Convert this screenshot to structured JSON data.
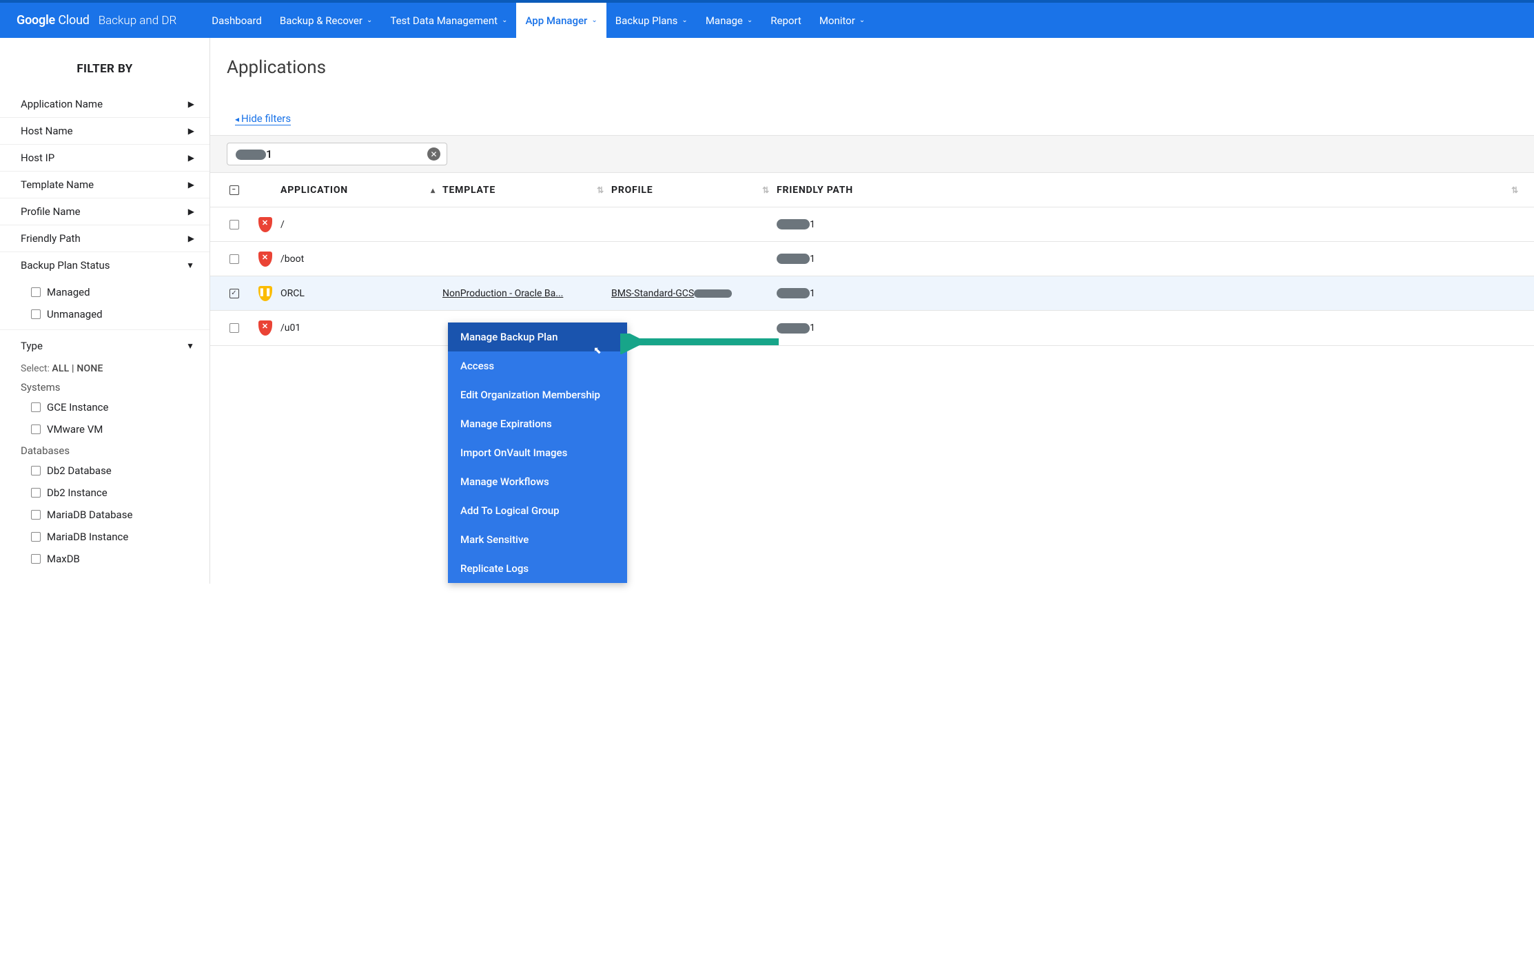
{
  "brand": {
    "google": "Google",
    "cloud": "Cloud",
    "product": "Backup and DR"
  },
  "nav": {
    "dashboard": "Dashboard",
    "backup_recover": "Backup & Recover",
    "test_data": "Test Data Management",
    "app_manager": "App Manager",
    "backup_plans": "Backup Plans",
    "manage": "Manage",
    "report": "Report",
    "monitor": "Monitor"
  },
  "sidebar": {
    "title": "FILTER BY",
    "filters": [
      "Application Name",
      "Host Name",
      "Host IP",
      "Template Name",
      "Profile Name",
      "Friendly Path",
      "Backup Plan Status"
    ],
    "plan_status_options": [
      "Managed",
      "Unmanaged"
    ],
    "type_label": "Type",
    "select_label": "Select:",
    "select_all": "ALL",
    "select_sep": " | ",
    "select_none": "NONE",
    "systems_label": "Systems",
    "systems": [
      "GCE Instance",
      "VMware VM"
    ],
    "databases_label": "Databases",
    "databases": [
      "Db2 Database",
      "Db2 Instance",
      "MariaDB Database",
      "MariaDB Instance",
      "MaxDB"
    ]
  },
  "page": {
    "title": "Applications",
    "hide_filters": "Hide filters",
    "chip_suffix": "1"
  },
  "cols": {
    "application": "APPLICATION",
    "template": "TEMPLATE",
    "profile": "PROFILE",
    "friendly": "FRIENDLY PATH"
  },
  "rows": [
    {
      "icon": "red",
      "app": "/",
      "template": "",
      "profile": "",
      "friendly_suffix": "1",
      "checked": false
    },
    {
      "icon": "red",
      "app": "/boot",
      "template": "",
      "profile": "",
      "friendly_suffix": "1",
      "checked": false
    },
    {
      "icon": "yellow",
      "app": "ORCL",
      "template": "NonProduction - Oracle Ba...",
      "profile": "BMS-Standard-GCS",
      "friendly_suffix": "1",
      "checked": true
    },
    {
      "icon": "red",
      "app": "/u01",
      "template": "",
      "profile": "",
      "friendly_suffix": "1",
      "checked": false
    }
  ],
  "ctx": {
    "items": [
      "Manage Backup Plan",
      "Access",
      "Edit Organization Membership",
      "Manage Expirations",
      "Import OnVault Images",
      "Manage Workflows",
      "Add To Logical Group",
      "Mark Sensitive",
      "Replicate Logs"
    ],
    "active": 0
  }
}
